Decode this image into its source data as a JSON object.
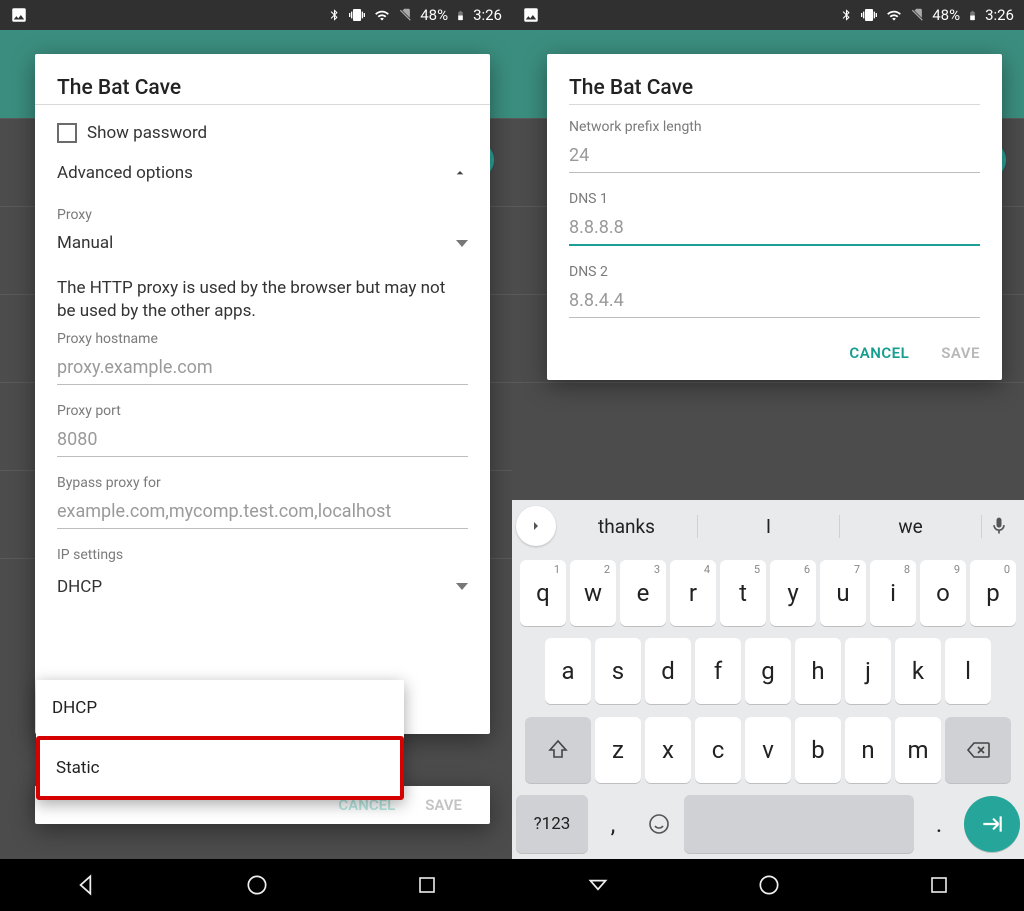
{
  "status": {
    "battery": "48%",
    "time": "3:26"
  },
  "left": {
    "title": "The Bat Cave",
    "show_password": "Show password",
    "advanced_options": "Advanced options",
    "proxy_label": "Proxy",
    "proxy_value": "Manual",
    "proxy_hint": "The HTTP proxy is used by the browser but may not be used by the other apps.",
    "hostname_label": "Proxy hostname",
    "hostname_placeholder": "proxy.example.com",
    "port_label": "Proxy port",
    "port_placeholder": "8080",
    "bypass_label": "Bypass proxy for",
    "bypass_placeholder": "example.com,mycomp.test.com,localhost",
    "ip_label": "IP settings",
    "ip_options": [
      "DHCP",
      "Static"
    ],
    "cancel": "CANCEL",
    "save": "SAVE"
  },
  "right": {
    "title": "The Bat Cave",
    "prefix_label": "Network prefix length",
    "prefix_value": "24",
    "dns1_label": "DNS 1",
    "dns1_placeholder": "8.8.8.8",
    "dns2_label": "DNS 2",
    "dns2_placeholder": "8.8.4.4",
    "cancel": "CANCEL",
    "save": "SAVE"
  },
  "keyboard": {
    "suggestions": [
      "thanks",
      "I",
      "we"
    ],
    "row1": [
      [
        "q",
        "1"
      ],
      [
        "w",
        "2"
      ],
      [
        "e",
        "3"
      ],
      [
        "r",
        "4"
      ],
      [
        "t",
        "5"
      ],
      [
        "y",
        "6"
      ],
      [
        "u",
        "7"
      ],
      [
        "i",
        "8"
      ],
      [
        "o",
        "9"
      ],
      [
        "p",
        "0"
      ]
    ],
    "row2": [
      "a",
      "s",
      "d",
      "f",
      "g",
      "h",
      "j",
      "k",
      "l"
    ],
    "row3": [
      "z",
      "x",
      "c",
      "v",
      "b",
      "n",
      "m"
    ],
    "symbols": "?123",
    "comma": ",",
    "period": "."
  }
}
